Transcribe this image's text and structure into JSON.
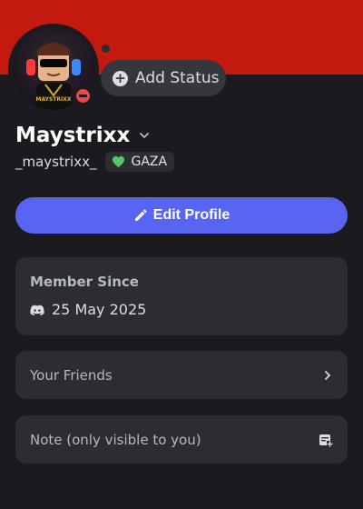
{
  "profile": {
    "display_name": "Maystrixx",
    "username": "_maystrixx_",
    "tag_label": "GAZA",
    "status_button_label": "Add Status",
    "edit_button_label": "Edit Profile"
  },
  "avatar": {
    "shirt_text": "MAYSTRIXX"
  },
  "member_since": {
    "title": "Member Since",
    "date": "25 May 2025"
  },
  "friends": {
    "label": "Your Friends"
  },
  "note": {
    "label": "Note (only visible to you)"
  },
  "colors": {
    "banner": "#c4190f",
    "background": "#1b1b1f",
    "card": "#2b2d31",
    "accent": "#5865f2",
    "dnd_status": "#e5484d",
    "tag_heart": "#57c46b"
  },
  "icons": {
    "status_plus": "plus-circle-icon",
    "name_chevron": "chevron-down-icon",
    "tag_heart": "green-heart-icon",
    "edit": "pencil-icon",
    "member": "discord-logo-icon",
    "friends_arrow": "chevron-right-icon",
    "note": "note-add-icon"
  }
}
